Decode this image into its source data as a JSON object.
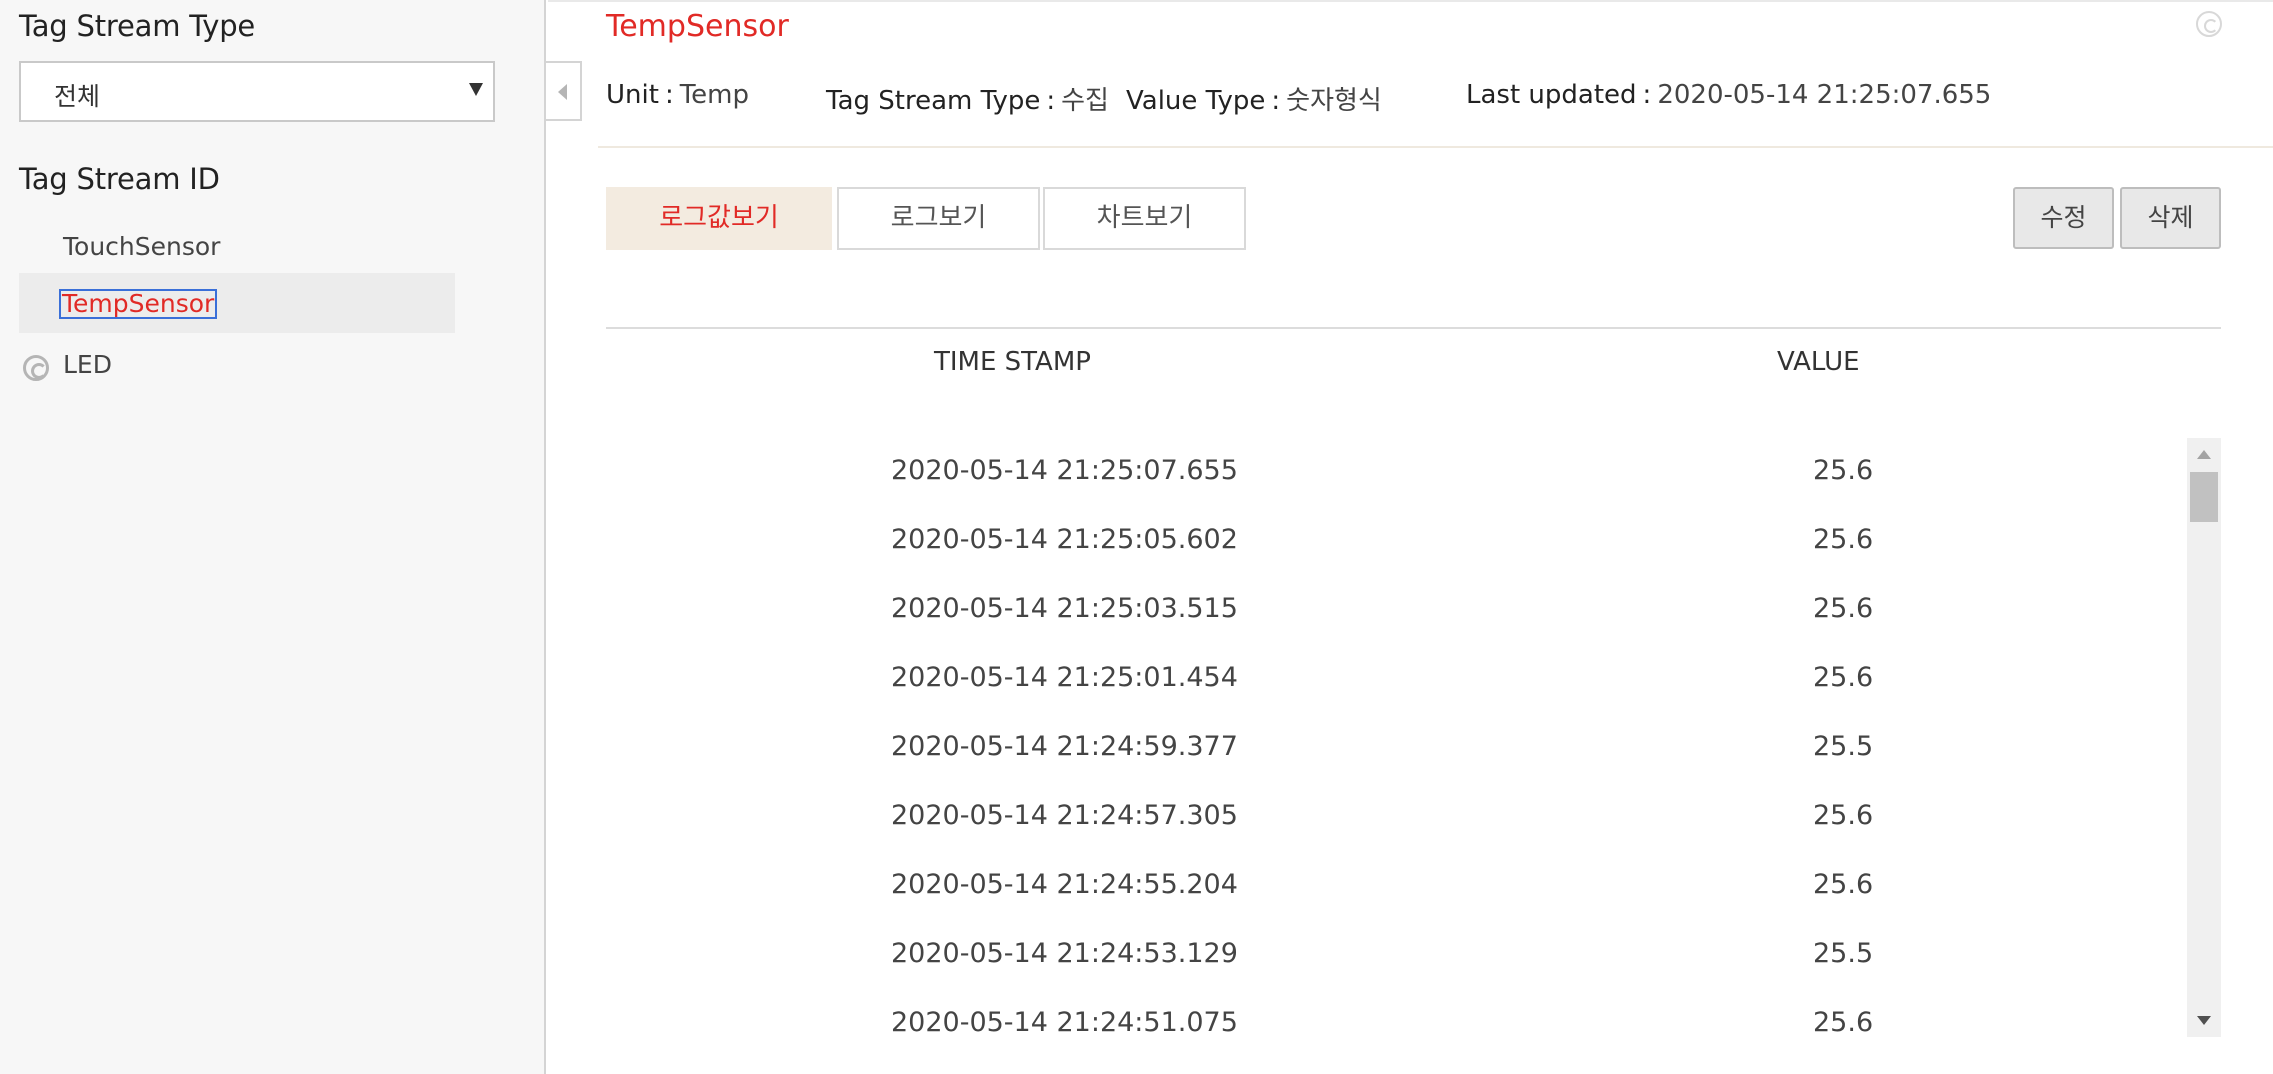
{
  "sidebar": {
    "type_heading": "Tag Stream Type",
    "type_select": {
      "selected": "전체"
    },
    "id_heading": "Tag Stream ID",
    "items": [
      {
        "label": "TouchSensor"
      },
      {
        "label": "TempSensor"
      },
      {
        "label": "LED",
        "icon": "copyright-circle-icon"
      }
    ]
  },
  "main": {
    "title": "TempSensor",
    "meta": {
      "unit_label": "Unit",
      "unit_value": "Temp",
      "stream_type_label": "Tag Stream Type",
      "stream_type_value": "수집",
      "value_type_label": "Value Type",
      "value_type_value": "숫자형식",
      "updated_label": "Last updated",
      "updated_value": "2020-05-14 21:25:07.655",
      "separator": ":"
    },
    "tabs": [
      {
        "label": "로그값보기"
      },
      {
        "label": "로그보기"
      },
      {
        "label": "차트보기"
      }
    ],
    "actions": {
      "edit": "수정",
      "delete": "삭제"
    },
    "table": {
      "headers": {
        "timestamp": "TIME STAMP",
        "value": "VALUE"
      },
      "rows": [
        {
          "timestamp": "2020-05-14 21:25:07.655",
          "value": "25.6"
        },
        {
          "timestamp": "2020-05-14 21:25:05.602",
          "value": "25.6"
        },
        {
          "timestamp": "2020-05-14 21:25:03.515",
          "value": "25.6"
        },
        {
          "timestamp": "2020-05-14 21:25:01.454",
          "value": "25.6"
        },
        {
          "timestamp": "2020-05-14 21:24:59.377",
          "value": "25.5"
        },
        {
          "timestamp": "2020-05-14 21:24:57.305",
          "value": "25.6"
        },
        {
          "timestamp": "2020-05-14 21:24:55.204",
          "value": "25.6"
        },
        {
          "timestamp": "2020-05-14 21:24:53.129",
          "value": "25.5"
        },
        {
          "timestamp": "2020-05-14 21:24:51.075",
          "value": "25.6"
        }
      ]
    }
  },
  "colors": {
    "accent_red": "#e12a26",
    "active_tab_bg": "#f3ebe0",
    "sidebar_bg": "#f7f7f7",
    "selection_outline": "#3a6fd8"
  }
}
